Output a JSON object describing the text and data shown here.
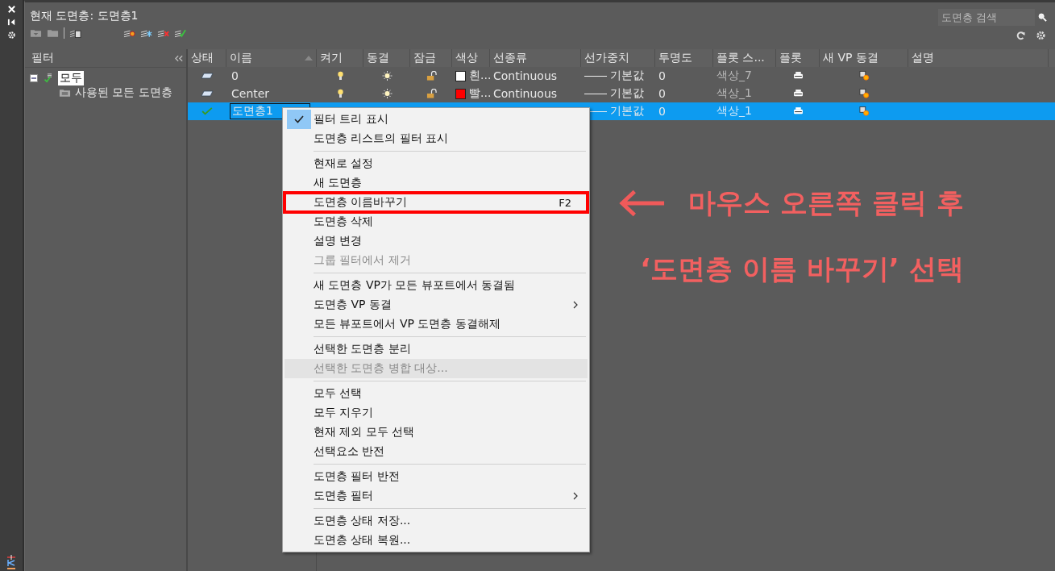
{
  "title": "현재 도면층: 도면층1",
  "search": {
    "placeholder": "도면층 검색"
  },
  "filter_panel": {
    "title": "필터",
    "tree": [
      {
        "label": "모두",
        "selected": true,
        "expanded": true,
        "children": [
          {
            "label": "사용된 모든 도면층",
            "selected": false
          }
        ]
      }
    ]
  },
  "table": {
    "columns": [
      {
        "label": "상태",
        "sorted": false
      },
      {
        "label": "이름",
        "sorted": true
      },
      {
        "label": "켜기",
        "sorted": false
      },
      {
        "label": "동결",
        "sorted": false
      },
      {
        "label": "잠금",
        "sorted": false
      },
      {
        "label": "색상",
        "sorted": false
      },
      {
        "label": "선종류",
        "sorted": false
      },
      {
        "label": "선가중치",
        "sorted": false
      },
      {
        "label": "투명도",
        "sorted": false
      },
      {
        "label": "플롯 스...",
        "sorted": false
      },
      {
        "label": "플롯",
        "sorted": false
      },
      {
        "label": "새 VP 동결",
        "sorted": false
      },
      {
        "label": "설명",
        "sorted": false
      }
    ],
    "rows": [
      {
        "kind": "layer",
        "name": "0",
        "on": true,
        "frozen": false,
        "locked": false,
        "color": "#ffffff",
        "color_name": "흰...",
        "linetype": "Continuous",
        "lineweight": "기본값",
        "transparency": "0",
        "plot_style": "색상_7",
        "selected": false
      },
      {
        "kind": "layer",
        "name": "Center",
        "on": true,
        "frozen": false,
        "locked": false,
        "color": "#ff0000",
        "color_name": "빨...",
        "linetype": "Continuous",
        "lineweight": "기본값",
        "transparency": "0",
        "plot_style": "색상_1",
        "selected": false
      },
      {
        "kind": "current",
        "name": "도면층1",
        "lineweight": "기본값",
        "transparency": "0",
        "plot_style": "색상_1",
        "selected": true
      }
    ]
  },
  "context_menu": [
    {
      "kind": "item",
      "label": "필터 트리 표시",
      "checked": true,
      "disabled": false,
      "hover": false
    },
    {
      "kind": "item",
      "label": "도면층 리스트의 필터 표시",
      "checked": false,
      "disabled": false,
      "hover": false
    },
    {
      "kind": "separator"
    },
    {
      "kind": "item",
      "label": "현재로 설정",
      "checked": false,
      "disabled": false,
      "hover": false
    },
    {
      "kind": "item",
      "label": "새 도면층",
      "checked": false,
      "disabled": false,
      "hover": false
    },
    {
      "kind": "item",
      "label": "도면층 이름바꾸기",
      "shortcut": "F2",
      "checked": false,
      "disabled": false,
      "hover": false,
      "annotated": true
    },
    {
      "kind": "item",
      "label": "도면층 삭제",
      "checked": false,
      "disabled": false,
      "hover": false
    },
    {
      "kind": "item",
      "label": "설명 변경",
      "checked": false,
      "disabled": false,
      "hover": false
    },
    {
      "kind": "item",
      "label": "그룹 필터에서 제거",
      "checked": false,
      "disabled": true,
      "hover": false
    },
    {
      "kind": "separator"
    },
    {
      "kind": "item",
      "label": "새 도면층 VP가 모든 뷰포트에서 동결됨",
      "checked": false,
      "disabled": false,
      "hover": false
    },
    {
      "kind": "item",
      "label": "도면층 VP 동결",
      "checked": false,
      "disabled": false,
      "hover": false,
      "submenu": true
    },
    {
      "kind": "item",
      "label": "모든 뷰포트에서 VP 도면층 동결해제",
      "checked": false,
      "disabled": false,
      "hover": false
    },
    {
      "kind": "separator"
    },
    {
      "kind": "item",
      "label": "선택한 도면층 분리",
      "checked": false,
      "disabled": false,
      "hover": false
    },
    {
      "kind": "item",
      "label": "선택한 도면층 병합 대상...",
      "checked": false,
      "disabled": true,
      "hover": true
    },
    {
      "kind": "separator"
    },
    {
      "kind": "item",
      "label": "모두 선택",
      "checked": false,
      "disabled": false,
      "hover": false
    },
    {
      "kind": "item",
      "label": "모두 지우기",
      "checked": false,
      "disabled": false,
      "hover": false
    },
    {
      "kind": "item",
      "label": "현재 제외 모두 선택",
      "checked": false,
      "disabled": false,
      "hover": false
    },
    {
      "kind": "item",
      "label": "선택요소 반전",
      "checked": false,
      "disabled": false,
      "hover": false
    },
    {
      "kind": "separator"
    },
    {
      "kind": "item",
      "label": "도면층 필터 반전",
      "checked": false,
      "disabled": false,
      "hover": false
    },
    {
      "kind": "item",
      "label": "도면층 필터",
      "checked": false,
      "disabled": false,
      "hover": false,
      "submenu": true
    },
    {
      "kind": "separator"
    },
    {
      "kind": "item",
      "label": "도면층 상태 저장...",
      "checked": false,
      "disabled": false,
      "hover": false
    },
    {
      "kind": "item",
      "label": "도면층 상태 복원...",
      "checked": false,
      "disabled": false,
      "hover": false
    }
  ],
  "annotation": {
    "lines": [
      "마우스 오른쪽 클릭 후",
      "‘도면층 이름 바꾸기’ 선택"
    ]
  }
}
